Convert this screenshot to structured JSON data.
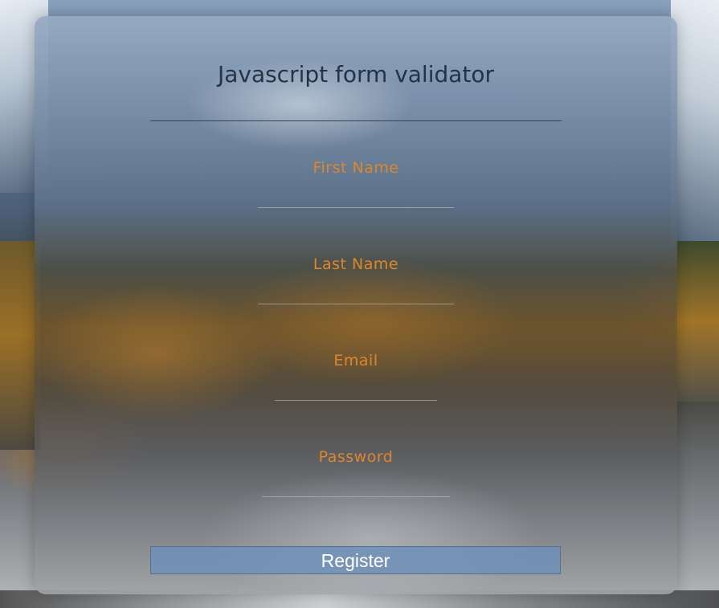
{
  "form": {
    "title": "Javascript form validator",
    "fields": [
      {
        "label": "First Name",
        "value": "",
        "type": "text"
      },
      {
        "label": "Last Name",
        "value": "",
        "type": "text"
      },
      {
        "label": "Email",
        "value": "",
        "type": "email"
      },
      {
        "label": "Password",
        "value": "",
        "type": "password"
      }
    ],
    "submit_label": "Register"
  },
  "colors": {
    "label": "#e0862a",
    "title": "#243446",
    "button_bg": "#6e91b9",
    "button_text": "#ffffff"
  }
}
